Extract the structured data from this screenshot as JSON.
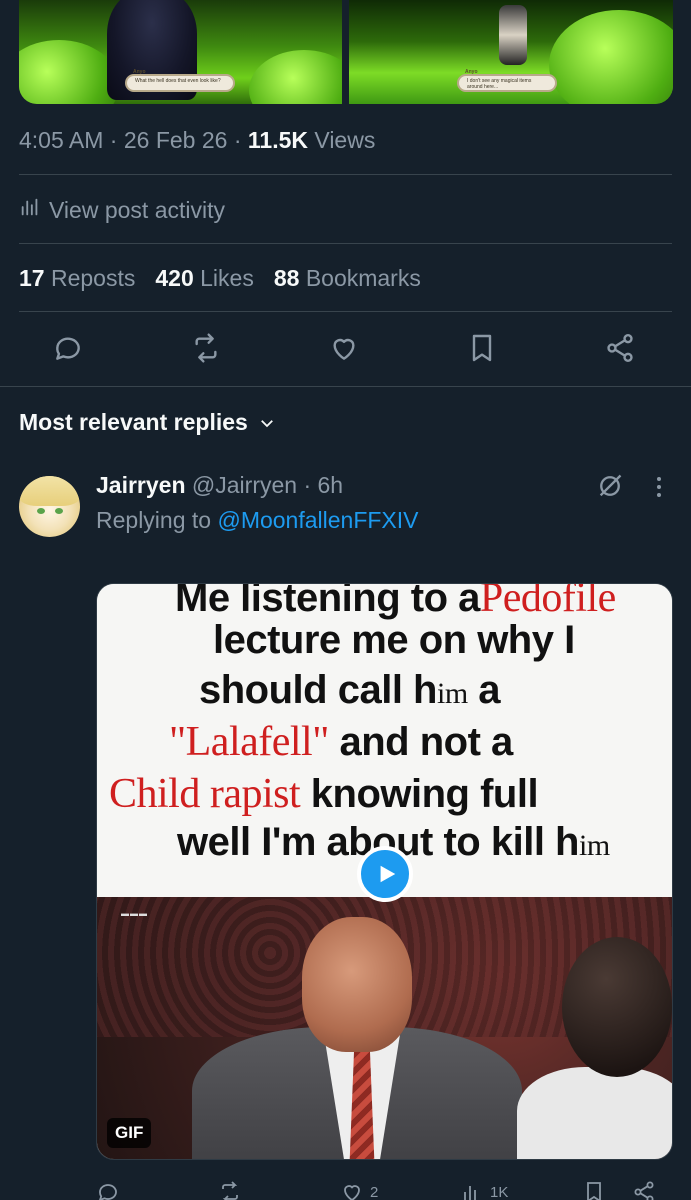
{
  "media": {
    "left": {
      "speaker": "Anyo",
      "dialog": "What the hell does that even look like?"
    },
    "right": {
      "speaker": "Anyo",
      "dialog": "I don't see any magical items around here..."
    }
  },
  "post_meta": {
    "time": "4:05 AM",
    "sep1": " · ",
    "date": "26 Feb 26",
    "sep2": " · ",
    "views_count": "11.5K",
    "views_label": " Views"
  },
  "activity": {
    "label": "View post activity"
  },
  "stats": {
    "reposts_count": "17",
    "reposts_label": "Reposts",
    "likes_count": "420",
    "likes_label": "Likes",
    "bookmarks_count": "88",
    "bookmarks_label": "Bookmarks"
  },
  "replies_header": {
    "label": "Most relevant replies"
  },
  "reply": {
    "name": "Jairryen",
    "handle": "@Jairryen",
    "sep": " · ",
    "age": "6h",
    "replying_prefix": "Replying to ",
    "replying_to": "@MoonfallenFFXIV",
    "gif_badge": "GIF",
    "meme": {
      "line1": "Me listening to a",
      "line1_red": "Pedofile",
      "line2": "lecture me on why I",
      "line3a": "should call h",
      "line3b": "im",
      "line3c": " a",
      "line4_red": "\"Lalafell\"",
      "line4": " and not a",
      "line5_red": "Child rapist",
      "line5": " knowing full",
      "line6a": "well I'm about to kill h",
      "line6b": "im"
    },
    "actions": {
      "likes": "2",
      "views": "1K"
    }
  },
  "colors": {
    "background": "#15202b",
    "text_primary": "#f7f9f9",
    "text_secondary": "#8b98a5",
    "accent": "#1d9bf0",
    "divider": "#38444d"
  },
  "icons": {
    "activity": "bar-chart-icon",
    "reply": "comment-icon",
    "repost": "repost-icon",
    "like": "heart-icon",
    "bookmark": "bookmark-icon",
    "share": "share-icon",
    "chevron": "chevron-down-icon",
    "grok": "grok-icon",
    "more": "more-vertical-icon",
    "play": "play-icon"
  }
}
